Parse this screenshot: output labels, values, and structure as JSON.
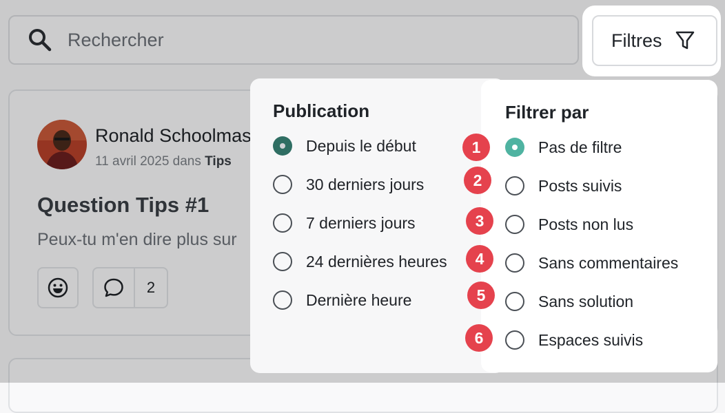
{
  "search": {
    "placeholder": "Rechercher"
  },
  "filter_button": {
    "label": "Filtres"
  },
  "post": {
    "author": "Ronald Schoolmaster",
    "date": "11 avril 2025 dans",
    "space": "Tips",
    "title": "Question Tips #1",
    "excerpt": "Peux-tu m'en dire plus sur",
    "comment_count": "2"
  },
  "publication": {
    "title": "Publication",
    "options": [
      {
        "label": "Depuis le début",
        "selected": true
      },
      {
        "label": "30 derniers jours",
        "selected": false
      },
      {
        "label": "7 derniers jours",
        "selected": false
      },
      {
        "label": "24 dernières heures",
        "selected": false
      },
      {
        "label": "Dernière heure",
        "selected": false
      }
    ]
  },
  "filter_by": {
    "title": "Filtrer par",
    "options": [
      {
        "label": "Pas de filtre",
        "selected": true
      },
      {
        "label": "Posts suivis",
        "selected": false
      },
      {
        "label": "Posts non lus",
        "selected": false
      },
      {
        "label": "Sans commentaires",
        "selected": false
      },
      {
        "label": "Sans solution",
        "selected": false
      },
      {
        "label": "Espaces suivis",
        "selected": false
      }
    ]
  },
  "badges": [
    "1",
    "2",
    "3",
    "4",
    "5",
    "6"
  ],
  "colors": {
    "accent": "#4fb3a1",
    "badge": "#e5424d"
  }
}
